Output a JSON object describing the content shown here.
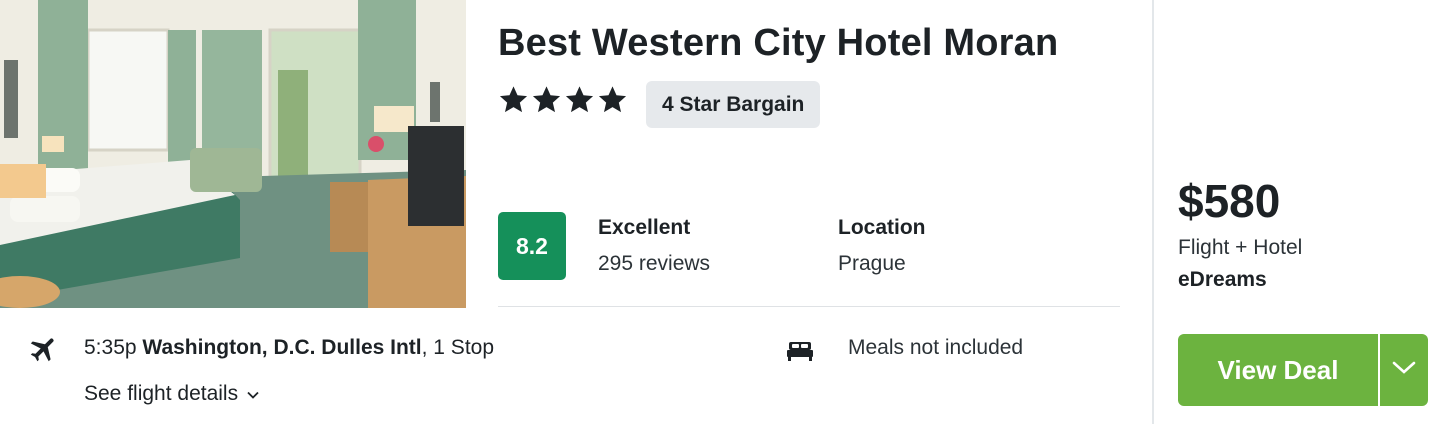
{
  "hotel": {
    "name": "Best Western City Hotel Moran",
    "star_count": 4,
    "star_badge": "4 Star Bargain",
    "photo_alt": "hotel-room-photo"
  },
  "rating": {
    "score": "8.2",
    "word": "Excellent",
    "reviews": "295 reviews"
  },
  "location": {
    "label": "Location",
    "value": "Prague"
  },
  "flight": {
    "time": "5:35p",
    "airport": "Washington, D.C. Dulles Intl",
    "stops": ", 1 Stop",
    "details_link": "See flight details"
  },
  "meals": {
    "text": "Meals not included"
  },
  "deal": {
    "price": "$580",
    "package": "Flight + Hotel",
    "provider": "eDreams",
    "button_label": "View Deal"
  },
  "colors": {
    "score_bg": "#15905a",
    "deal_button": "#6cb33f",
    "badge_bg": "#e6e9ec"
  },
  "icons": {
    "plane": "plane-icon",
    "bed": "bed-icon",
    "star": "star-icon",
    "chevron": "chevron-down-icon"
  }
}
